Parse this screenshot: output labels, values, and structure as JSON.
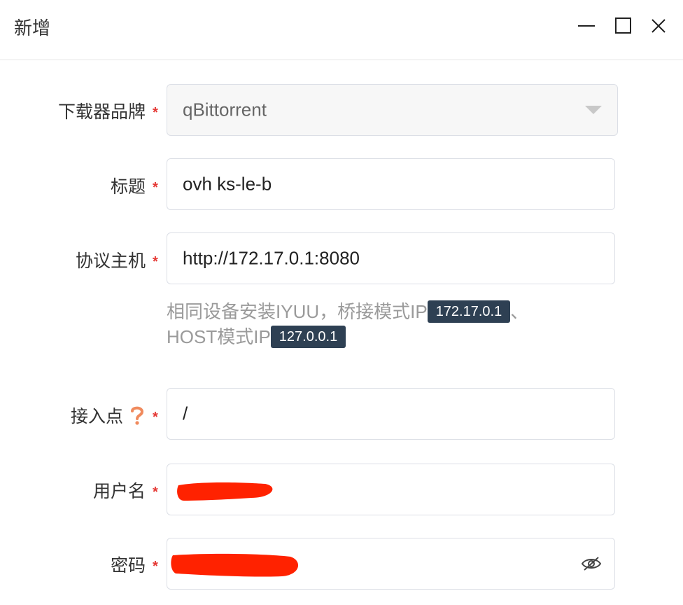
{
  "window": {
    "title": "新增",
    "controls": [
      "minimize-icon",
      "maximize-icon",
      "close-icon"
    ]
  },
  "form": {
    "brand": {
      "label": "下载器品牌",
      "value": "qBittorrent",
      "required": true
    },
    "title": {
      "label": "标题",
      "value": "ovh ks-le-b",
      "required": true
    },
    "host": {
      "label": "协议主机",
      "value": "http://172.17.0.1:8080",
      "required": true,
      "hint_prefix": "相同设备安装IYUU，桥接模式IP",
      "bridge_ip": "172.17.0.1",
      "hint_sep": "、",
      "hint_host": "HOST模式IP",
      "host_ip": "127.0.0.1"
    },
    "endpoint": {
      "label": "接入点",
      "value": "/",
      "required": true,
      "help_icon": "question-icon"
    },
    "username": {
      "label": "用户名",
      "required": true,
      "redacted": true
    },
    "password": {
      "label": "密码",
      "required": true,
      "redacted": true,
      "toggle_icon": "eye-off-icon"
    }
  },
  "colors": {
    "required_asterisk": "#e53935",
    "badge_bg": "#2e4053",
    "help_icon": "#f08a5d",
    "redaction": "#ff2200"
  }
}
